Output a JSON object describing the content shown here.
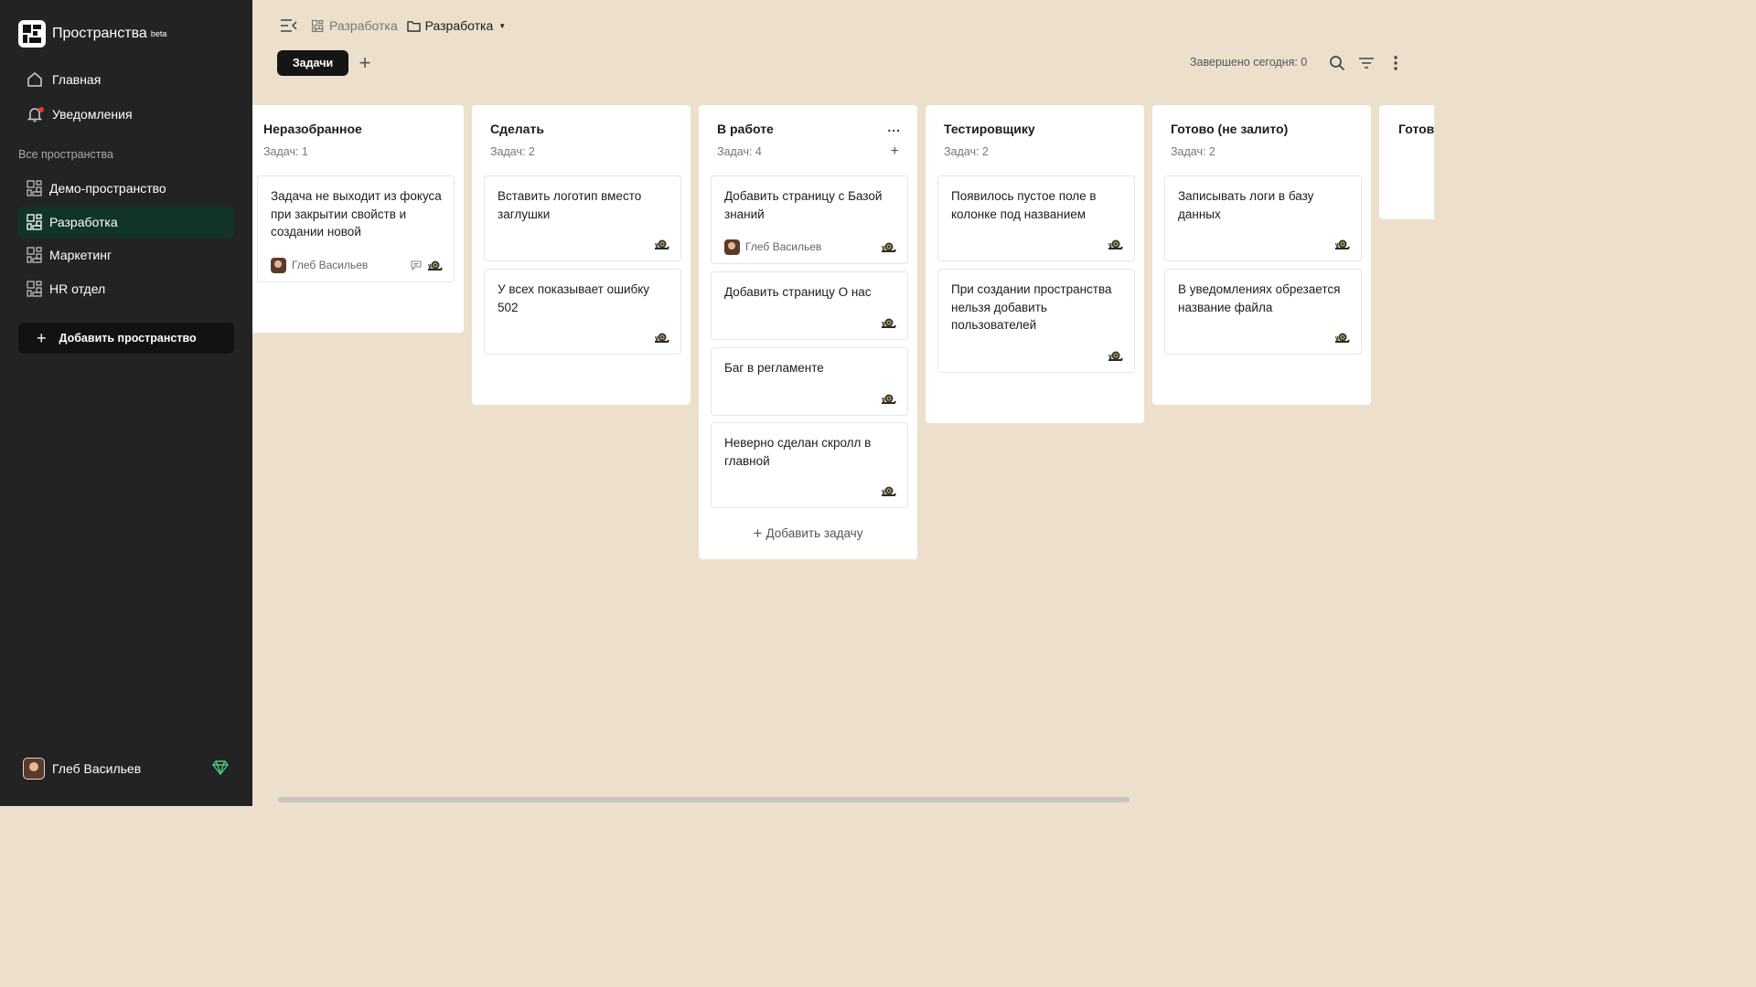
{
  "sidebar": {
    "brand_title": "Пространства",
    "brand_badge": "beta",
    "nav": [
      {
        "label": "Главная"
      },
      {
        "label": "Уведомления"
      }
    ],
    "section_label": "Все пространства",
    "spaces": [
      {
        "label": "Демо-пространство"
      },
      {
        "label": "Разработка"
      },
      {
        "label": "Маркетинг"
      },
      {
        "label": "HR отдел"
      }
    ],
    "add_space_label": "Добавить пространство",
    "user_name": "Глеб Васильев"
  },
  "header": {
    "breadcrumb_space": "Разработка",
    "breadcrumb_folder": "Разработка",
    "tab_active": "Задачи",
    "tab_add": "+",
    "completed_today": "Завершено сегодня: 0"
  },
  "board": {
    "columns": [
      {
        "title": "Неразобранное",
        "count": "Задач: 1",
        "cards": [
          {
            "title": "Задача не выходит из фокуса при закрытии свойств и создании новой",
            "assignee": "Глеб Васильев"
          }
        ]
      },
      {
        "title": "Сделать",
        "count": "Задач: 2",
        "cards": [
          {
            "title": "Вставить логотип вместо заглушки"
          },
          {
            "title": "У всех показывает ошибку 502"
          }
        ]
      },
      {
        "title": "В работе",
        "count": "Задач: 4",
        "more": "...",
        "add_task": "Добавить задачу",
        "cards": [
          {
            "title": "Добавить страницу с Базой знаний",
            "assignee": "Глеб Васильев"
          },
          {
            "title": "Добавить страницу О нас"
          },
          {
            "title": "Баг в регламенте"
          },
          {
            "title": "Неверно сделан скролл в главной"
          }
        ]
      },
      {
        "title": "Тестировщику",
        "count": "Задач: 2",
        "cards": [
          {
            "title": "Появилось пустое поле в колонке под названием"
          },
          {
            "title": "При создании пространства нельзя добавить пользователей"
          }
        ]
      },
      {
        "title": "Готово (не залито)",
        "count": "Задач: 2",
        "cards": [
          {
            "title": "Записывать логи в базу данных"
          },
          {
            "title": "В уведомлениях обрезается название файла"
          }
        ]
      },
      {
        "title": "Готово"
      }
    ]
  },
  "colors": {
    "sidebar_bg": "#232323",
    "active_space_bg": "#11342a",
    "board_bg": "#ecdfcc",
    "accent_gem": "#4ec38b"
  }
}
